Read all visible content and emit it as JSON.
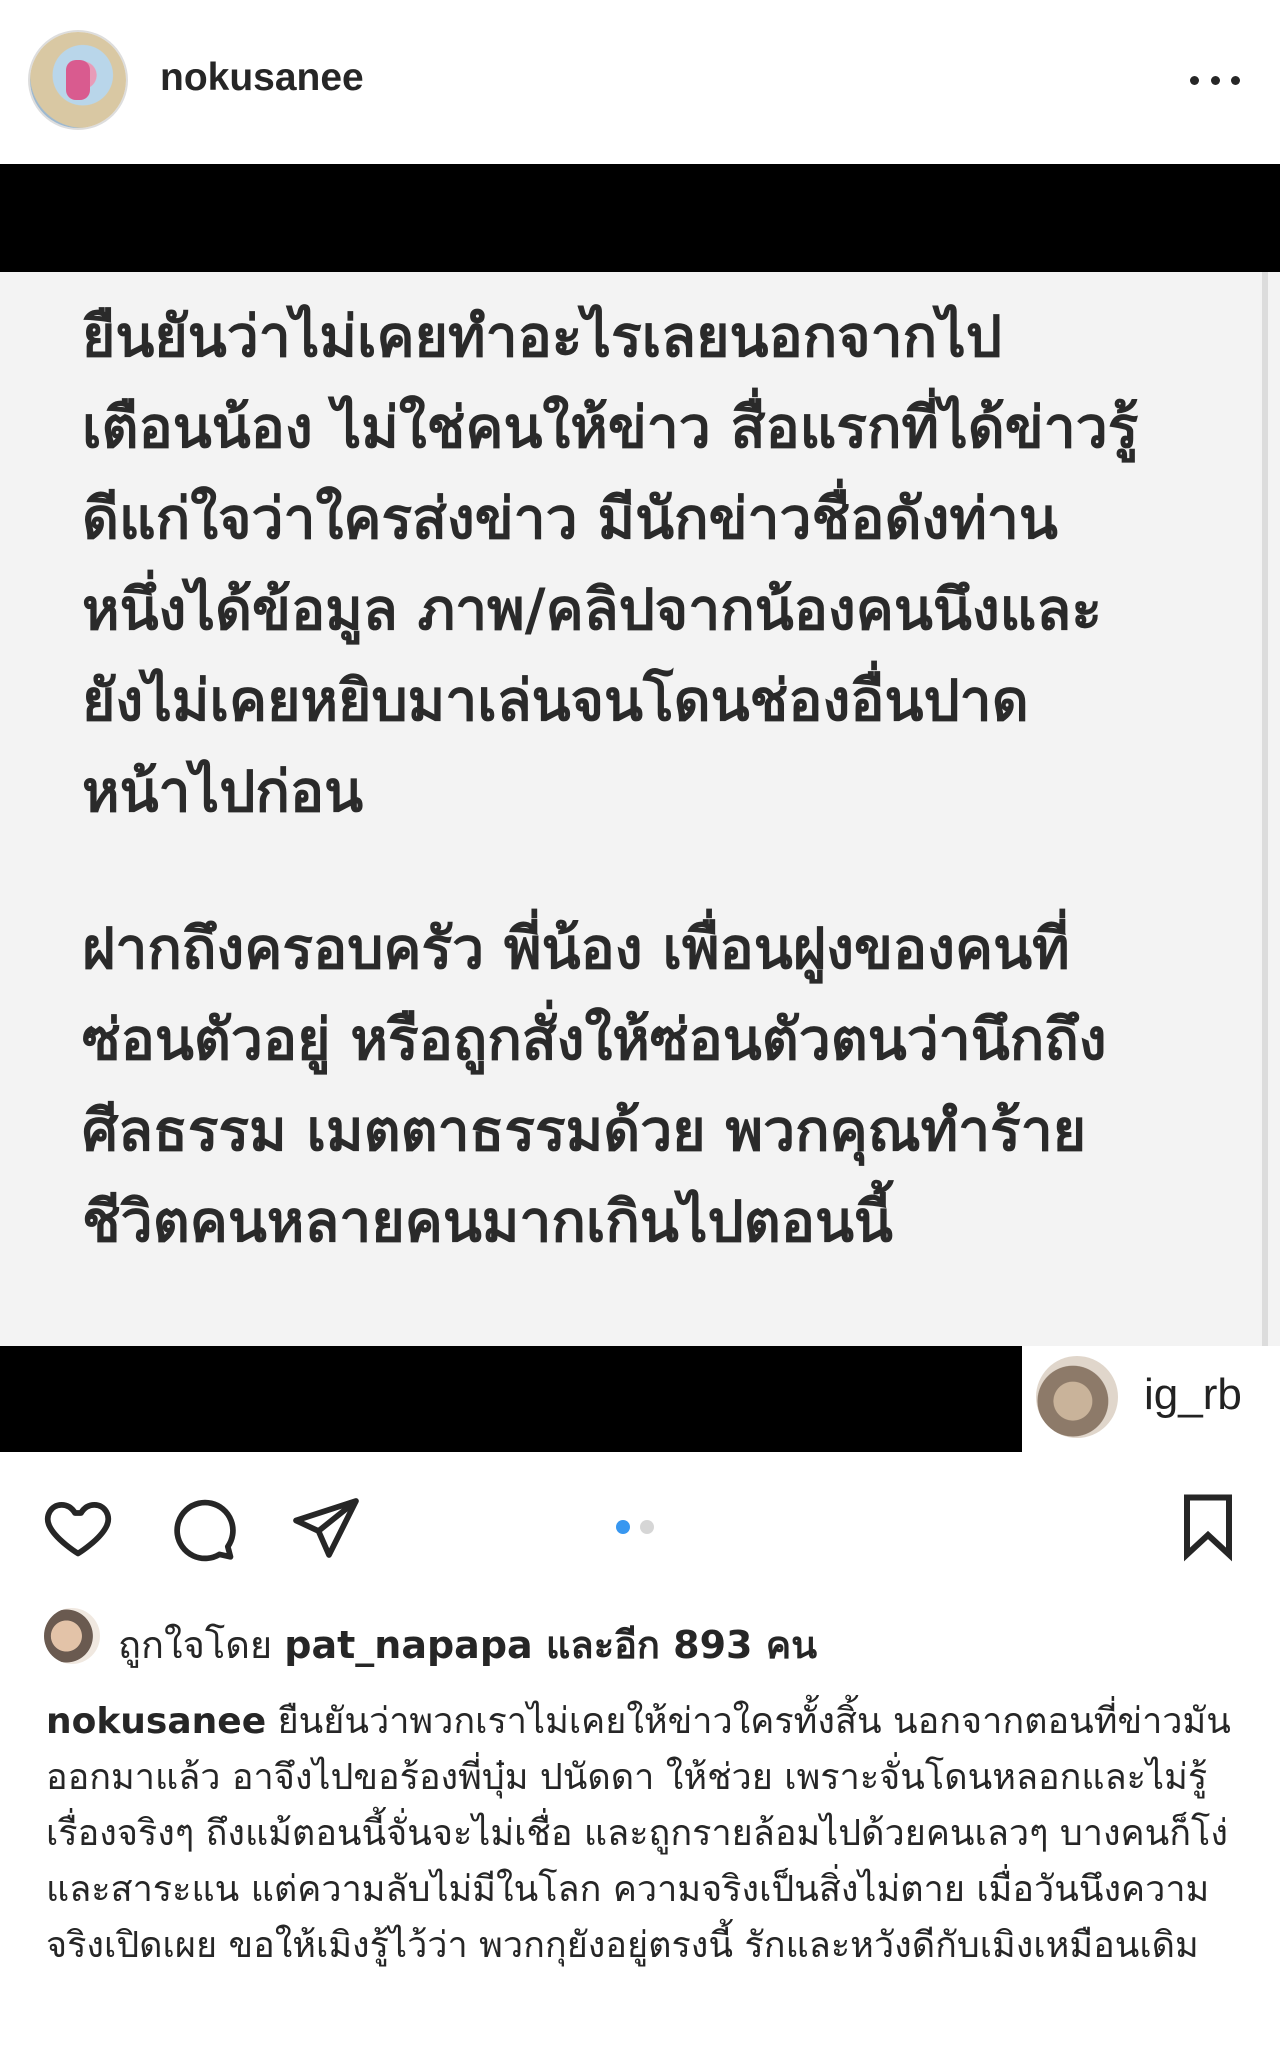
{
  "header": {
    "username": "nokusanee"
  },
  "post": {
    "paragraph1": "ยืนยันว่าไม่เคยทำอะไรเลยนอกจากไป\nเตือนน้อง ไม่ใช่คนให้ข่าว สื่อแรกที่ได้ข่าวรู้\nดีแก่ใจว่าใครส่งข่าว มีนักข่าวชื่อดังท่าน\nหนึ่งได้ข้อมูล ภาพ/คลิปจากน้องคนนึงและ\nยังไม่เคยหยิบมาเล่นจนโดนช่องอื่นปาด\nหน้าไปก่อน",
    "paragraph2": "ฝากถึงครอบครัว พี่น้อง เพื่อนฝูงของคนที่\nซ่อนตัวอยู่ หรือถูกสั่งให้ซ่อนตัวตนว่านึกถึง\nศีลธรรม เมตตาธรรมด้วย พวกคุณทำร้าย\nชีวิตคนหลายคนมากเกินไปตอนนี้",
    "credit_name": "ig_rb"
  },
  "carousel": {
    "total": 2,
    "active": 1
  },
  "likes": {
    "prefix": "ถูกใจโดย ",
    "user": "pat_napapa",
    "suffix": " และอีก 893 คน"
  },
  "caption": {
    "username": "nokusanee",
    "text": " ยืนยันว่าพวกเราไม่เคยให้ข่าวใครทั้งสิ้น นอกจากตอนที่ข่าวมันออกมาแล้ว อาจึงไปขอร้องพี่บุ๋ม ปนัดดา ให้ช่วย เพราะจั่นโดนหลอกและไม่รู้เรื่องจริงๆ ถึงแม้ตอนนี้จั่นจะไม่เชื่อ และถูกรายล้อมไปด้วยคนเลวๆ บางคนก็โง่และสาระแน แต่ความลับไม่มีในโลก ความจริงเป็นสิ่งไม่ตาย เมื่อวันนึงความจริงเปิดเผย ขอให้เมิงรู้ไว้ว่า พวกกุยังอยู่ตรงนี้ รักและหวังดีกับเมิงเหมือนเดิม"
  },
  "icons": {
    "more": "more-options-icon",
    "like": "heart-icon",
    "comment": "comment-icon",
    "share": "share-icon",
    "save": "bookmark-icon"
  },
  "colors": {
    "text": "#262626",
    "active_dot": "#3897f0",
    "inactive_dot": "#d6d6d6",
    "image_band": "#000000",
    "image_bg": "#f3f3f3"
  }
}
